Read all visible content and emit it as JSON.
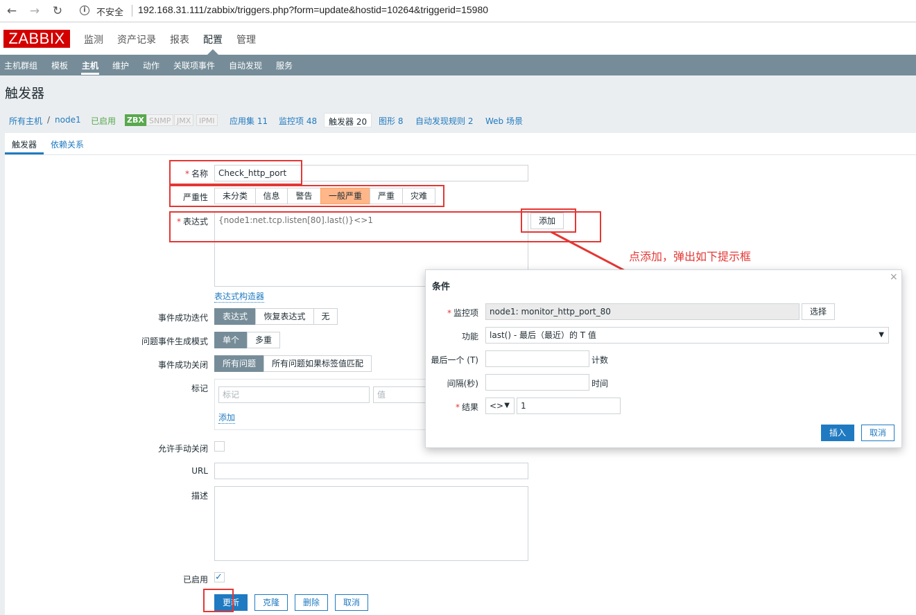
{
  "browser": {
    "insecure_label": "不安全",
    "url": "192.168.31.111/zabbix/triggers.php?form=update&hostid=10264&triggerid=15980"
  },
  "app": {
    "logo": "ZABBIX",
    "top_menu": [
      "监测",
      "资产记录",
      "报表",
      "配置",
      "管理"
    ],
    "sub_menu": [
      "主机群组",
      "模板",
      "主机",
      "维护",
      "动作",
      "关联项事件",
      "自动发现",
      "服务"
    ]
  },
  "page": {
    "title": "触发器"
  },
  "host_nav": {
    "all_hosts": "所有主机",
    "separator": "/",
    "host": "node1",
    "status": "已启用",
    "badges": [
      "ZBX",
      "SNMP",
      "JMX",
      "IPMI"
    ],
    "applications": "应用集 11",
    "items": "监控项 48",
    "triggers": "触发器 20",
    "graphs": "图形 8",
    "discovery": "自动发现规则 2",
    "web": "Web 场景"
  },
  "tabs": [
    "触发器",
    "依赖关系"
  ],
  "form": {
    "name_label": "名称",
    "name_value": "Check_http_port",
    "severity_label": "严重性",
    "severity_options": [
      "未分类",
      "信息",
      "警告",
      "一般严重",
      "严重",
      "灾难"
    ],
    "expression_label": "表达式",
    "expression_value": "{node1:net.tcp.listen[80].last()}<>1",
    "add_button": "添加",
    "expr_builder": "表达式构造器",
    "ok_event_label": "事件成功迭代",
    "ok_event_options": [
      "表达式",
      "恢复表达式",
      "无"
    ],
    "problem_mode_label": "问题事件生成模式",
    "problem_mode_options": [
      "单个",
      "多重"
    ],
    "ok_close_label": "事件成功关闭",
    "ok_close_options": [
      "所有问题",
      "所有问题如果标签值匹配"
    ],
    "tags_label": "标记",
    "tag_placeholder": "标记",
    "value_placeholder": "值",
    "tag_add": "添加",
    "manual_close_label": "允许手动关闭",
    "url_label": "URL",
    "desc_label": "描述",
    "enabled_label": "已启用",
    "buttons": {
      "update": "更新",
      "clone": "克隆",
      "delete": "删除",
      "cancel": "取消"
    }
  },
  "dialog": {
    "title": "条件",
    "close": "×",
    "item_label": "监控项",
    "item_value": "node1: monitor_http_port_80",
    "select_button": "选择",
    "function_label": "功能",
    "function_value": "last() - 最后（最近）的 T 值",
    "last_label": "最后一个 (T)",
    "last_unit": "计数",
    "interval_label": "间隔(秒)",
    "interval_unit": "时间",
    "result_label": "结果",
    "result_operator": "<>",
    "result_value": "1",
    "insert_button": "插入",
    "cancel_button": "取消"
  },
  "annotation": "点添加，弹出如下提示框",
  "colors": {
    "accent": "#1f7ac1",
    "annotation": "#e33734",
    "subnav": "#768d99",
    "severity_selected": "#ffb689"
  }
}
